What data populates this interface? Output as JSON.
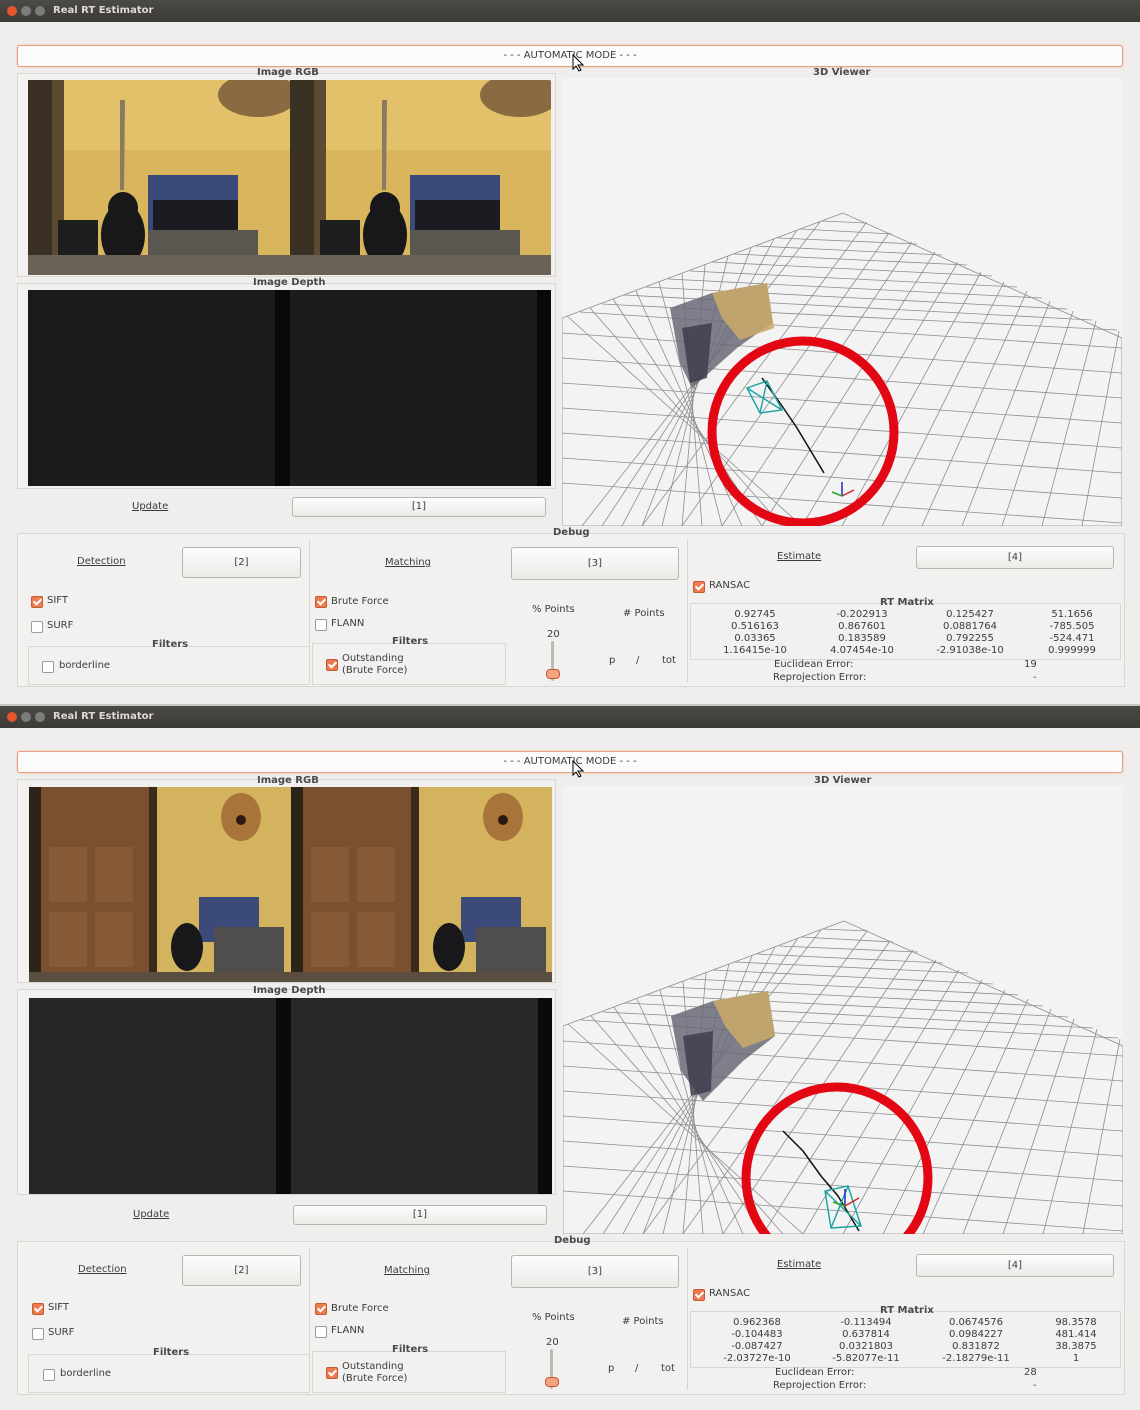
{
  "colors": {
    "accent": "#ee7a4f",
    "circle": "#e30613",
    "titlebar": "#3c3b37",
    "frustum": "#17a2a0"
  },
  "windows": [
    {
      "title": "Real RT Estimator",
      "mode_button": "- - - AUTOMATIC MODE - - -",
      "image_rgb_label": "Image RGB",
      "image_depth_label": "Image Depth",
      "viewer_label": "3D Viewer",
      "update_label": "Update",
      "update_value": "[1]",
      "debug_label": "Debug",
      "detection": {
        "label": "Detection",
        "value": "[2]",
        "sift": "SIFT",
        "surf": "SURF",
        "filters_label": "Filters",
        "borderline": "borderline"
      },
      "matching": {
        "label": "Matching",
        "value": "[3]",
        "brute_force": "Brute Force",
        "flann": "FLANN",
        "filters_label": "Filters",
        "outstanding_line1": "Outstanding",
        "outstanding_line2": "(Brute Force)",
        "pct_points": "% Points",
        "num_points": "# Points",
        "slider_value": "20",
        "p": "p",
        "slash": "/",
        "tot": "tot"
      },
      "estimate": {
        "label": "Estimate",
        "value": "[4]",
        "ransac": "RANSAC",
        "rt_matrix_label": "RT Matrix",
        "matrix": [
          [
            "0.92745",
            "-0.202913",
            "0.125427",
            "51.1656"
          ],
          [
            "0.516163",
            "0.867601",
            "0.0881764",
            "-785.505"
          ],
          [
            "0.03365",
            "0.183589",
            "0.792255",
            "-524.471"
          ],
          [
            "1.16415e-10",
            "4.07454e-10",
            "-2.91038e-10",
            "0.999999"
          ]
        ],
        "euclidean_label": "Euclidean Error:",
        "euclidean_value": "19",
        "reprojection_label": "Reprojection Error:",
        "reprojection_value": "-"
      }
    },
    {
      "title": "Real RT Estimator",
      "mode_button": "- - - AUTOMATIC MODE - - -",
      "image_rgb_label": "Image RGB",
      "image_depth_label": "Image Depth",
      "viewer_label": "3D Viewer",
      "update_label": "Update",
      "update_value": "[1]",
      "debug_label": "Debug",
      "detection": {
        "label": "Detection",
        "value": "[2]",
        "sift": "SIFT",
        "surf": "SURF",
        "filters_label": "Filters",
        "borderline": "borderline"
      },
      "matching": {
        "label": "Matching",
        "value": "[3]",
        "brute_force": "Brute Force",
        "flann": "FLANN",
        "filters_label": "Filters",
        "outstanding_line1": "Outstanding",
        "outstanding_line2": "(Brute Force)",
        "pct_points": "% Points",
        "num_points": "# Points",
        "slider_value": "20",
        "p": "p",
        "slash": "/",
        "tot": "tot"
      },
      "estimate": {
        "label": "Estimate",
        "value": "[4]",
        "ransac": "RANSAC",
        "rt_matrix_label": "RT Matrix",
        "matrix": [
          [
            "0.962368",
            "-0.113494",
            "0.0674576",
            "98.3578"
          ],
          [
            "-0.104483",
            "0.637814",
            "0.0984227",
            "481.414"
          ],
          [
            "-0.087427",
            "0.0321803",
            "0.831872",
            "38.3875"
          ],
          [
            "-2.03727e-10",
            "-5.82077e-11",
            "-2.18279e-11",
            "1"
          ]
        ],
        "euclidean_label": "Euclidean Error:",
        "euclidean_value": "28",
        "reprojection_label": "Reprojection Error:",
        "reprojection_value": "-"
      }
    }
  ]
}
